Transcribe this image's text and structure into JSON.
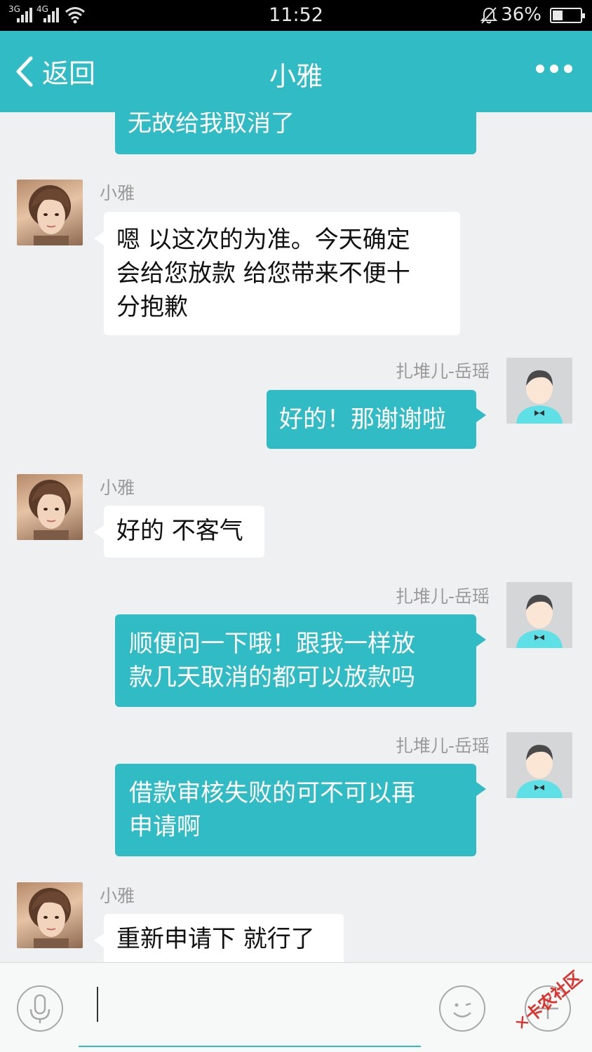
{
  "status_bar": {
    "sim1": "3G",
    "sim2": "4G",
    "time": "11:52",
    "battery_pct": "36%",
    "battery_level": 0.36
  },
  "nav": {
    "back_label": "返回",
    "title": "小雅",
    "more_icon": "more-dots-icon"
  },
  "messages": [
    {
      "from": "out",
      "text": "无故给我取消了"
    },
    {
      "from": "in",
      "sender": "小雅",
      "lines": [
        "嗯 以这次的为准。今天确定",
        "会给您放款 给您带来不便十",
        "分抱歉"
      ]
    },
    {
      "from": "out",
      "sender": "扎堆儿-岳瑶",
      "lines": [
        "好的！那谢谢啦"
      ]
    },
    {
      "from": "in",
      "sender": "小雅",
      "lines": [
        "好的 不客气"
      ]
    },
    {
      "from": "out",
      "sender": "扎堆儿-岳瑶",
      "lines": [
        "顺便问一下哦！跟我一样放",
        "款几天取消的都可以放款吗"
      ]
    },
    {
      "from": "out",
      "sender": "扎堆儿-岳瑶",
      "lines": [
        "借款审核失败的可不可以再",
        "申请啊"
      ]
    },
    {
      "from": "in",
      "sender": "小雅",
      "lines": [
        "重新申请下 就行了"
      ]
    }
  ],
  "input_bar": {
    "voice_icon": "microphone-icon",
    "emoji_icon": "smiley-icon",
    "plus_icon": "plus-icon",
    "text_value": ""
  },
  "watermark": "卡农社区",
  "colors": {
    "accent": "#31bbc5",
    "background": "#eef0f1",
    "status_bar": "#000000"
  }
}
